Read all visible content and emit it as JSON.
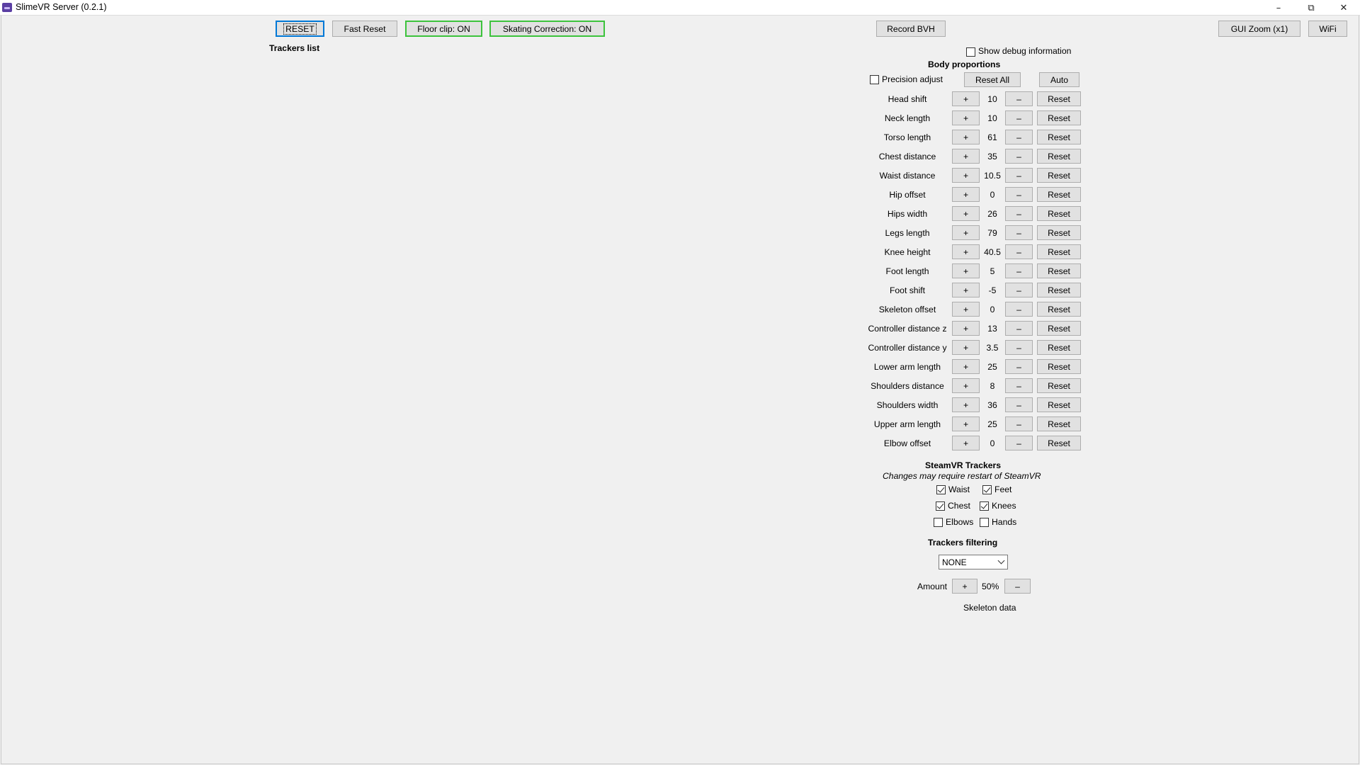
{
  "window": {
    "title": "SlimeVR Server (0.2.1)",
    "minimize_glyph": "–",
    "maximize_glyph": "⧉",
    "close_glyph": "✕"
  },
  "toolbar": {
    "reset": "RESET",
    "fast_reset": "Fast Reset",
    "floor_clip": "Floor clip: ON",
    "skating_correction": "Skating Correction: ON",
    "record_bvh": "Record BVH",
    "gui_zoom": "GUI Zoom (x1)",
    "wifi": "WiFi"
  },
  "trackers_list": {
    "title": "Trackers list"
  },
  "debug": {
    "label": "Show debug information",
    "checked": false
  },
  "body_proportions": {
    "title": "Body proportions",
    "precision_adjust": "Precision adjust",
    "reset_all": "Reset All",
    "auto": "Auto",
    "plus": "+",
    "minus": "–",
    "reset": "Reset",
    "rows": [
      {
        "name": "Head shift",
        "value": "10"
      },
      {
        "name": "Neck length",
        "value": "10"
      },
      {
        "name": "Torso length",
        "value": "61"
      },
      {
        "name": "Chest distance",
        "value": "35"
      },
      {
        "name": "Waist distance",
        "value": "10.5"
      },
      {
        "name": "Hip offset",
        "value": "0"
      },
      {
        "name": "Hips width",
        "value": "26"
      },
      {
        "name": "Legs length",
        "value": "79"
      },
      {
        "name": "Knee height",
        "value": "40.5"
      },
      {
        "name": "Foot length",
        "value": "5"
      },
      {
        "name": "Foot shift",
        "value": "-5"
      },
      {
        "name": "Skeleton offset",
        "value": "0"
      },
      {
        "name": "Controller distance z",
        "value": "13"
      },
      {
        "name": "Controller distance y",
        "value": "3.5"
      },
      {
        "name": "Lower arm length",
        "value": "25"
      },
      {
        "name": "Shoulders distance",
        "value": "8"
      },
      {
        "name": "Shoulders width",
        "value": "36"
      },
      {
        "name": "Upper arm length",
        "value": "25"
      },
      {
        "name": "Elbow offset",
        "value": "0"
      }
    ]
  },
  "steamvr": {
    "title": "SteamVR Trackers",
    "subtitle": "Changes may require restart of SteamVR",
    "waist": "Waist",
    "feet": "Feet",
    "chest": "Chest",
    "knees": "Knees",
    "elbows": "Elbows",
    "hands": "Hands"
  },
  "filtering": {
    "title": "Trackers filtering",
    "selected": "NONE",
    "amount_label": "Amount",
    "amount_value": "50%",
    "plus": "+",
    "minus": "–"
  },
  "skeleton_data": {
    "label": "Skeleton data"
  }
}
